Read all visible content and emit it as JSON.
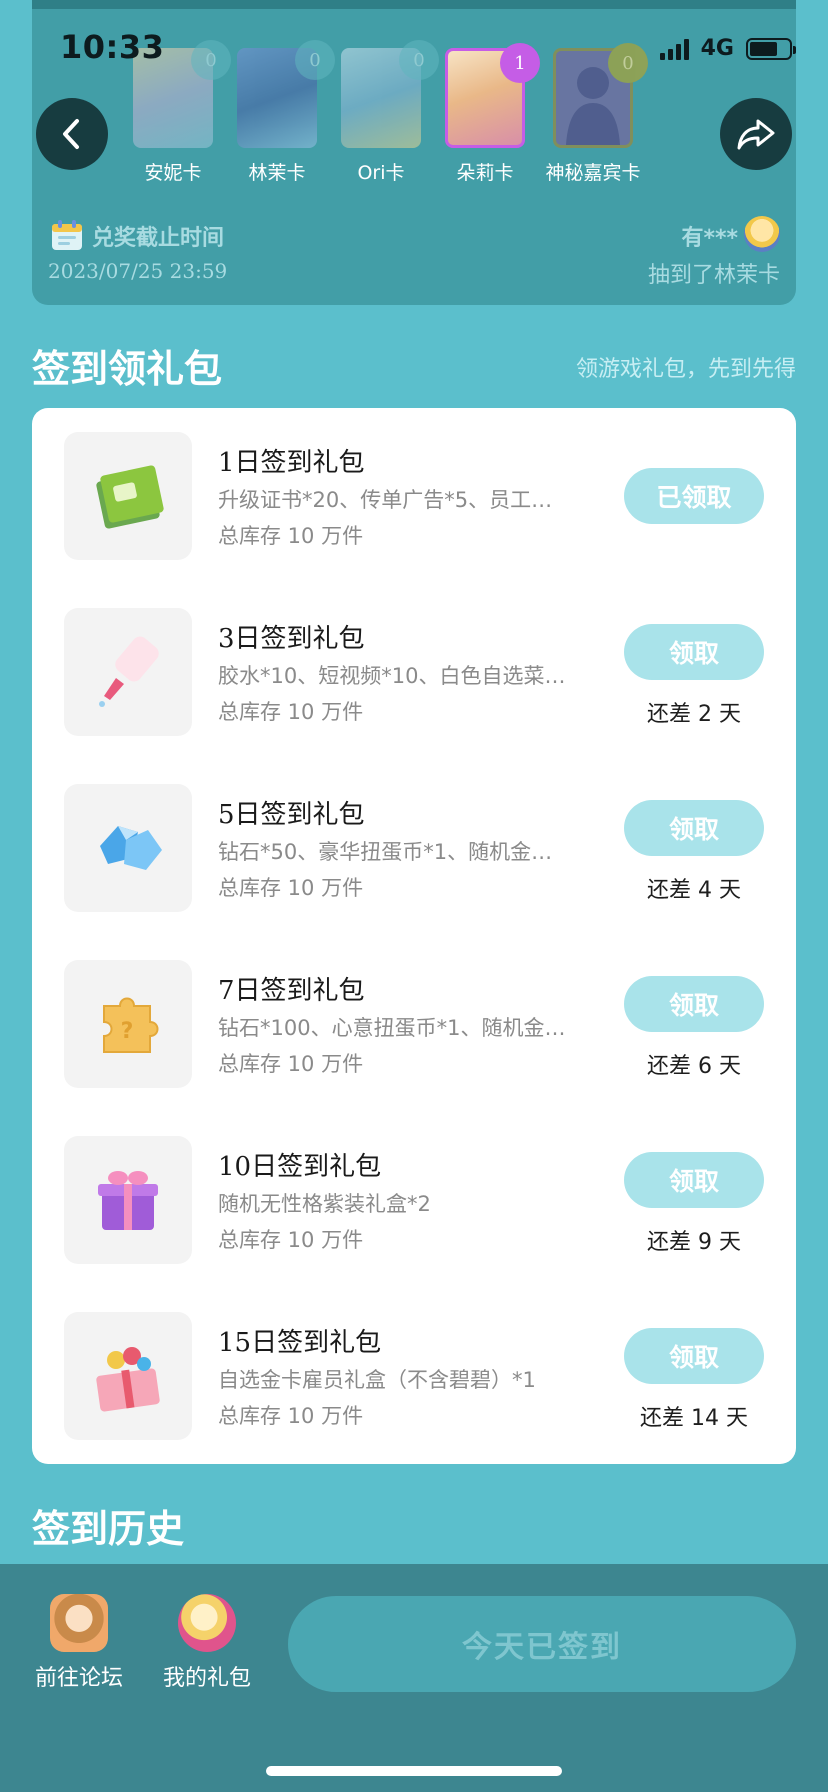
{
  "status_bar": {
    "time": "10:33",
    "network": "4G"
  },
  "cards": [
    {
      "name": "安妮卡",
      "count": "0",
      "state": "inactive"
    },
    {
      "name": "林茉卡",
      "count": "0",
      "state": "inactive"
    },
    {
      "name": "Ori卡",
      "count": "0",
      "state": "inactive"
    },
    {
      "name": "朵莉卡",
      "count": "1",
      "state": "active"
    },
    {
      "name": "神秘嘉宾卡",
      "count": "0",
      "state": "mystery"
    }
  ],
  "deadline": {
    "title": "兑奖截止时间",
    "date": "2023/07/25 23:59"
  },
  "winner": {
    "user": "有***",
    "text": "抽到了林茉卡"
  },
  "gift_section": {
    "title": "签到领礼包",
    "hint": "领游戏礼包，先到先得"
  },
  "gifts": [
    {
      "title": "1日签到礼包",
      "desc": "升级证书*20、传单广告*5、员工…",
      "stock": "总库存 10 万件",
      "button": "已领取",
      "remain": "",
      "icon": "certificate-icon"
    },
    {
      "title": "3日签到礼包",
      "desc": "胶水*10、短视频*10、白色自选菜…",
      "stock": "总库存 10 万件",
      "button": "领取",
      "remain": "还差 2 天",
      "icon": "glue-icon"
    },
    {
      "title": "5日签到礼包",
      "desc": "钻石*50、豪华扭蛋币*1、随机金…",
      "stock": "总库存 10 万件",
      "button": "领取",
      "remain": "还差 4 天",
      "icon": "diamond-icon"
    },
    {
      "title": "7日签到礼包",
      "desc": "钻石*100、心意扭蛋币*1、随机金…",
      "stock": "总库存 10 万件",
      "button": "领取",
      "remain": "还差 6 天",
      "icon": "puzzle-icon"
    },
    {
      "title": "10日签到礼包",
      "desc": "随机无性格紫装礼盒*2",
      "stock": "总库存 10 万件",
      "button": "领取",
      "remain": "还差 9 天",
      "icon": "purple-giftbox-icon"
    },
    {
      "title": "15日签到礼包",
      "desc": "自选金卡雇员礼盒（不含碧碧）*1",
      "stock": "总库存 10 万件",
      "button": "领取",
      "remain": "还差 14 天",
      "icon": "pink-giftbox-icon"
    }
  ],
  "history_section": {
    "title": "签到历史"
  },
  "bottom_bar": {
    "forum_label": "前往论坛",
    "mygift_label": "我的礼包",
    "signed_label": "今天已签到"
  },
  "colors": {
    "background": "#5bbfcc",
    "header_card": "#429ea7",
    "button": "#a9e3ea",
    "bottom_bar": "#3d8690",
    "active_card_border": "#c55de6"
  }
}
